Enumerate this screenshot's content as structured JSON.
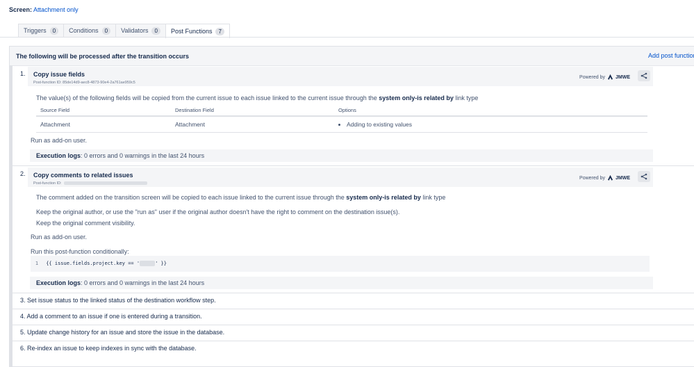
{
  "screen": {
    "label": "Screen:",
    "value": "Attachment only"
  },
  "tabs": [
    {
      "label": "Triggers",
      "count": "0"
    },
    {
      "label": "Conditions",
      "count": "0"
    },
    {
      "label": "Validators",
      "count": "0"
    },
    {
      "label": "Post Functions",
      "count": "7"
    }
  ],
  "panel": {
    "title": "The following will be processed after the transition occurs",
    "add_link": "Add post function"
  },
  "pf1": {
    "number": "1.",
    "title": "Copy issue fields",
    "id": "Post-function ID: 85de14d9-aec8-4873-90e4-2a761ae959c5",
    "powered_by": "Powered by",
    "brand": "JMWE",
    "desc_pre": "The value(s) of the following fields will be copied from the current issue to each issue linked to the current issue through the",
    "desc_bold": "system only-is related by",
    "desc_post": "link type",
    "table": {
      "headers": [
        "Source Field",
        "Destination Field",
        "Options"
      ],
      "row": {
        "source": "Attachment",
        "destination": "Attachment",
        "option": "Adding to existing values"
      }
    },
    "run_as": "Run as add-on user.",
    "exec_label": "Execution logs",
    "exec_text": ": 0 errors and 0 warnings in the last 24 hours"
  },
  "pf2": {
    "number": "2.",
    "title": "Copy comments to related issues",
    "id": "Post-function ID:",
    "powered_by": "Powered by",
    "brand": "JMWE",
    "desc_pre": "The comment added on the transition screen will be copied to each issue linked to the current issue through the",
    "desc_bold": "system only-is related by",
    "desc_post": "link type",
    "line1": "Keep the original author, or use the \"run as\" user if the original author doesn't have the right to comment on the destination issue(s).",
    "line2": "Keep the original comment visibility.",
    "run_as": "Run as add-on user.",
    "conditional": "Run this post-function conditionally:",
    "code_line": "1",
    "code_pre": "{{ issue.fields.project.key == '",
    "code_post": "' }}",
    "exec_label": "Execution logs",
    "exec_text": ": 0 errors and 0 warnings in the last 24 hours"
  },
  "simple_rows": [
    "3.  Set issue status to the linked status of the destination workflow step.",
    "4.  Add a comment to an issue if one is entered during a transition.",
    "5.  Update change history for an issue and store the issue in the database.",
    "6.  Re-index an issue to keep indexes in sync with the database."
  ],
  "colors": {
    "link": "#0052cc",
    "text": "#172b4d",
    "subtle": "#42526e",
    "bg_subtle": "#f4f5f7"
  },
  "icons": {
    "share": "share-icon",
    "jmwe_logo": "jmwe-logo-icon"
  }
}
